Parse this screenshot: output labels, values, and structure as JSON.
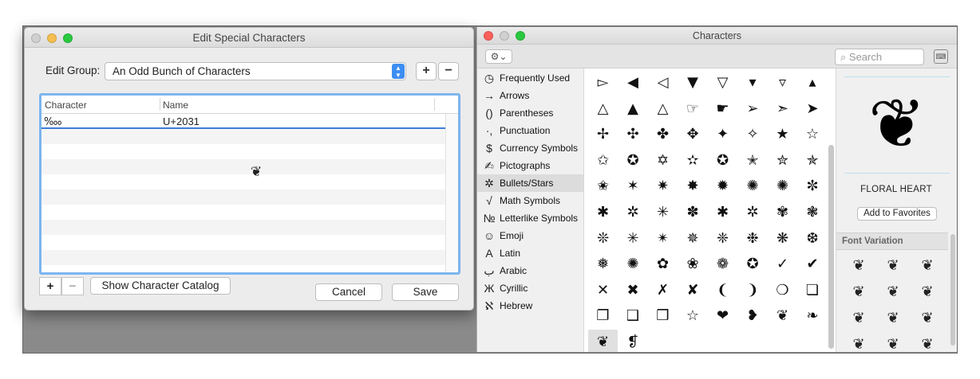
{
  "dialog": {
    "title": "Edit Special Characters",
    "edit_group_label": "Edit Group:",
    "group_value": "An Odd Bunch of Characters",
    "add_group": "+",
    "remove_group": "−",
    "columns": [
      "Character",
      "Name"
    ],
    "rows": [
      {
        "character": "‱",
        "name": "U+2031"
      }
    ],
    "cursor_glyph": "❦",
    "add_row": "+",
    "remove_row": "−",
    "show_catalog": "Show Character Catalog",
    "cancel": "Cancel",
    "save": "Save"
  },
  "viewer": {
    "title": "Characters",
    "gear": "⚙⌄",
    "search_placeholder": "Search",
    "keyboard_icon": "⌨",
    "categories": [
      {
        "icon": "◷",
        "label": "Frequently Used"
      },
      {
        "icon": "→",
        "label": "Arrows"
      },
      {
        "icon": "()",
        "label": "Parentheses"
      },
      {
        "icon": "·,",
        "label": "Punctuation"
      },
      {
        "icon": "$",
        "label": "Currency Symbols"
      },
      {
        "icon": "✍",
        "label": "Pictographs"
      },
      {
        "icon": "✲",
        "label": "Bullets/Stars"
      },
      {
        "icon": "√",
        "label": "Math Symbols"
      },
      {
        "icon": "№",
        "label": "Letterlike Symbols"
      },
      {
        "icon": "☺",
        "label": "Emoji"
      },
      {
        "icon": "A",
        "label": "Latin"
      },
      {
        "icon": "ب",
        "label": "Arabic"
      },
      {
        "icon": "Ж",
        "label": "Cyrillic"
      },
      {
        "icon": "ℵ",
        "label": "Hebrew"
      }
    ],
    "selected_category": "Bullets/Stars",
    "glyphs": [
      "▻",
      "◀",
      "◁",
      "▼",
      "▽",
      "▾",
      "▿",
      "▴",
      "△",
      "▲",
      "△",
      "☞",
      "☛",
      "➢",
      "➣",
      "➤",
      "✢",
      "✣",
      "✤",
      "✥",
      "✦",
      "✧",
      "★",
      "☆",
      "✩",
      "✪",
      "✡",
      "✫",
      "✪",
      "✭",
      "✮",
      "✯",
      "✬",
      "✶",
      "✷",
      "✸",
      "✹",
      "✺",
      "✺",
      "✼",
      "✱",
      "✲",
      "✳",
      "✽",
      "✱",
      "✲",
      "✾",
      "❃",
      "❊",
      "✳",
      "✴",
      "✵",
      "❈",
      "❉",
      "❋",
      "❆",
      "❅",
      "✺",
      "✿",
      "❀",
      "❁",
      "✪",
      "✓",
      "✔",
      "✕",
      "✖",
      "✗",
      "✘",
      "❨",
      "❩",
      "❍",
      "❏",
      "❐",
      "❑",
      "❒",
      "☆",
      "❤",
      "❥",
      "❦",
      "❧",
      "❦",
      "❡"
    ],
    "selected_glyph": "❦",
    "preview_glyph": "❦",
    "char_name": "FLORAL HEART",
    "add_favorites": "Add to Favorites",
    "font_variation_header": "Font Variation",
    "variations": [
      "❦",
      "❦",
      "❦",
      "❦",
      "❦",
      "❦",
      "❦",
      "❦",
      "❦",
      "❦",
      "❦",
      "❦"
    ]
  }
}
